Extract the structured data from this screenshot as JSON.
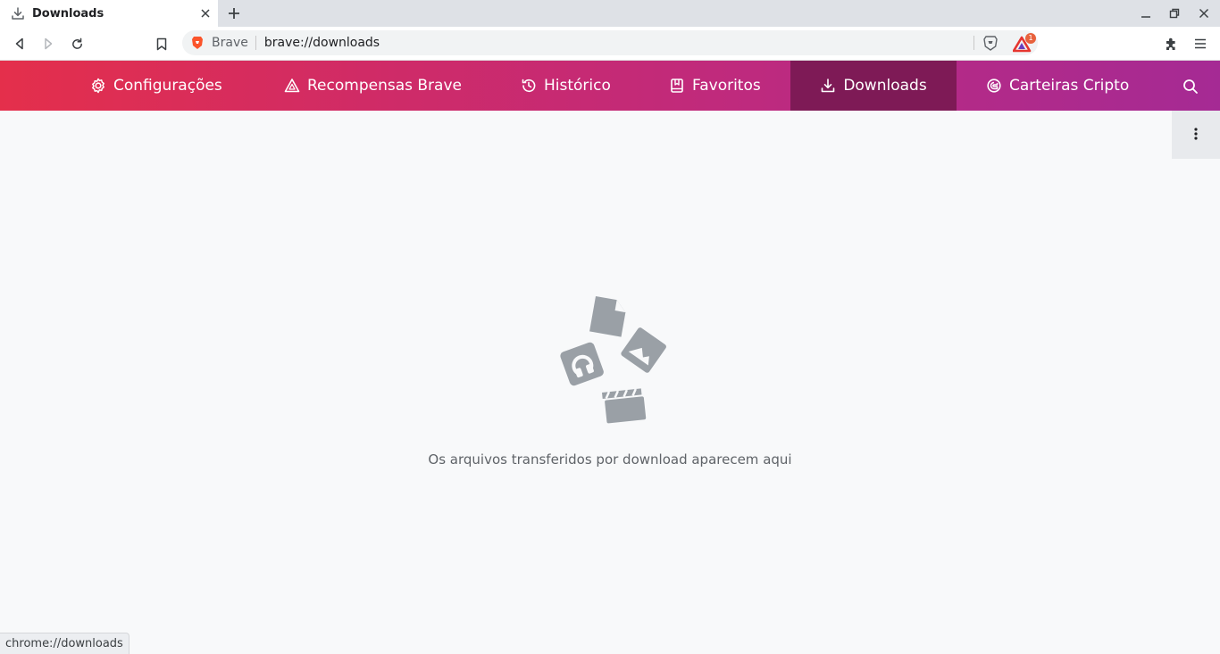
{
  "tab": {
    "title": "Downloads",
    "icon": "download-icon"
  },
  "window_controls": [
    "minimize-icon",
    "restore-icon",
    "close-icon"
  ],
  "toolbar": {
    "site_label": "Brave",
    "url": "brave://downloads",
    "rewards_badge": "1"
  },
  "nav": {
    "items": [
      {
        "label": "Configurações",
        "icon": "gear-icon"
      },
      {
        "label": "Recompensas Brave",
        "icon": "triangle-rewards-icon"
      },
      {
        "label": "Histórico",
        "icon": "history-clock-icon"
      },
      {
        "label": "Favoritos",
        "icon": "bookmark-book-icon"
      },
      {
        "label": "Downloads",
        "icon": "download-icon",
        "active": true
      },
      {
        "label": "Carteiras Cripto",
        "icon": "wallet-icon"
      }
    ]
  },
  "content": {
    "empty_message": "Os arquivos transferidos por download aparecem aqui"
  },
  "status_bar": {
    "text": "chrome://downloads"
  },
  "colors": {
    "nav_gradient_start": "#e42f4b",
    "nav_gradient_end": "#a52a94",
    "nav_active": "#7e1a56",
    "illustration_gray": "#9aa0a6"
  }
}
